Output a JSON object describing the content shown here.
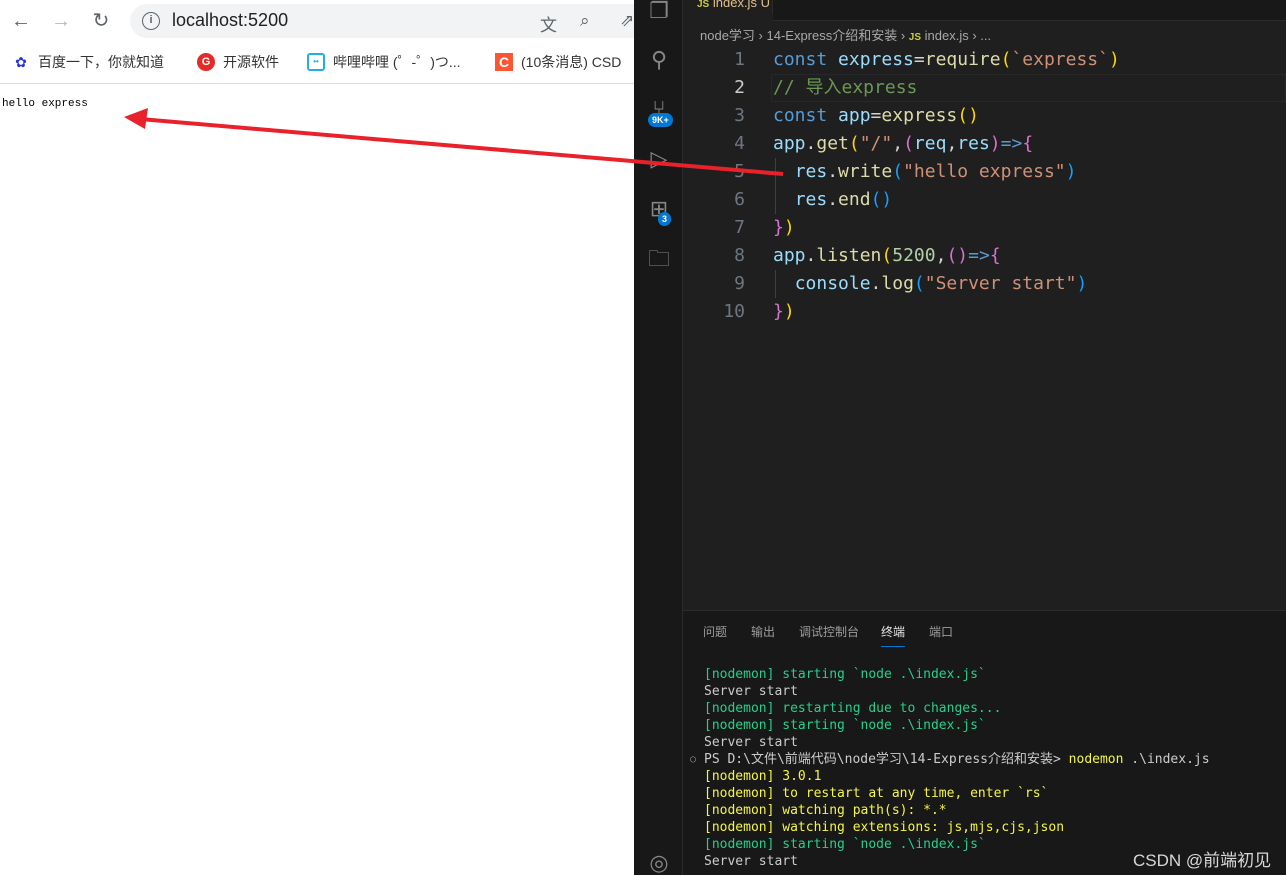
{
  "browser": {
    "url": "localhost:5200",
    "bookmarks": [
      {
        "label": "百度一下，你就知道",
        "icon": "baidu-icon"
      },
      {
        "label": "开源软件",
        "icon": "oschina-icon"
      },
      {
        "label": "哔哩哔哩 (゜-゜)つ...",
        "icon": "bilibili-icon"
      },
      {
        "label": "(10条消息) CSD",
        "icon": "csdn-icon"
      }
    ],
    "body_text": "hello express"
  },
  "editor": {
    "tab": {
      "icon": "JS",
      "name": "index.js",
      "status": "U"
    },
    "breadcrumb": [
      "node学习",
      "14-Express介绍和安装",
      "index.js",
      "..."
    ],
    "breadcrumb_js": "JS",
    "badges": {
      "source_control": "9K+",
      "extensions": "3"
    },
    "current_line": 2,
    "lines": [
      {
        "n": "1",
        "tokens": [
          [
            "kw",
            "const "
          ],
          [
            "var",
            "express"
          ],
          [
            "op",
            "="
          ],
          [
            "fn",
            "require"
          ],
          [
            "p1",
            "("
          ],
          [
            "str",
            "`express`"
          ],
          [
            "p1",
            ")"
          ]
        ]
      },
      {
        "n": "2",
        "tokens": [
          [
            "cm",
            "// 导入express"
          ]
        ]
      },
      {
        "n": "3",
        "tokens": [
          [
            "kw",
            "const "
          ],
          [
            "var",
            "app"
          ],
          [
            "op",
            "="
          ],
          [
            "fn",
            "express"
          ],
          [
            "p1",
            "()"
          ]
        ]
      },
      {
        "n": "4",
        "tokens": [
          [
            "var",
            "app"
          ],
          [
            "op",
            "."
          ],
          [
            "fn",
            "get"
          ],
          [
            "p1",
            "("
          ],
          [
            "str",
            "\"/\""
          ],
          [
            "op",
            ","
          ],
          [
            "p2",
            "("
          ],
          [
            "var",
            "req"
          ],
          [
            "op",
            ","
          ],
          [
            "var",
            "res"
          ],
          [
            "p2",
            ")"
          ],
          [
            "kw",
            "=>"
          ],
          [
            "p2",
            "{"
          ]
        ]
      },
      {
        "n": "5",
        "tokens": [
          [
            "op",
            "  "
          ],
          [
            "var",
            "res"
          ],
          [
            "op",
            "."
          ],
          [
            "fn",
            "write"
          ],
          [
            "p3",
            "("
          ],
          [
            "str",
            "\"hello express\""
          ],
          [
            "p3",
            ")"
          ]
        ]
      },
      {
        "n": "6",
        "tokens": [
          [
            "op",
            "  "
          ],
          [
            "var",
            "res"
          ],
          [
            "op",
            "."
          ],
          [
            "fn",
            "end"
          ],
          [
            "p3",
            "()"
          ]
        ]
      },
      {
        "n": "7",
        "tokens": [
          [
            "p2",
            "}"
          ],
          [
            "p1",
            ")"
          ]
        ]
      },
      {
        "n": "8",
        "tokens": [
          [
            "var",
            "app"
          ],
          [
            "op",
            "."
          ],
          [
            "fn",
            "listen"
          ],
          [
            "p1",
            "("
          ],
          [
            "num",
            "5200"
          ],
          [
            "op",
            ","
          ],
          [
            "p2",
            "()"
          ],
          [
            "kw",
            "=>"
          ],
          [
            "p2",
            "{"
          ]
        ]
      },
      {
        "n": "9",
        "tokens": [
          [
            "op",
            "  "
          ],
          [
            "var",
            "console"
          ],
          [
            "op",
            "."
          ],
          [
            "fn",
            "log"
          ],
          [
            "p3",
            "("
          ],
          [
            "str",
            "\"Server start\""
          ],
          [
            "p3",
            ")"
          ]
        ]
      },
      {
        "n": "10",
        "tokens": [
          [
            "p2",
            "}"
          ],
          [
            "p1",
            ")"
          ]
        ]
      }
    ]
  },
  "panel": {
    "tabs": [
      "问题",
      "输出",
      "调试控制台",
      "终端",
      "端口"
    ],
    "active_tab": "终端",
    "terminal": [
      {
        "c": "g",
        "t": "[nodemon] starting `node .\\index.js`"
      },
      {
        "c": "w",
        "t": "Server start"
      },
      {
        "c": "g",
        "t": "[nodemon] restarting due to changes..."
      },
      {
        "c": "g",
        "t": "[nodemon] starting `node .\\index.js`"
      },
      {
        "c": "w",
        "t": "Server start"
      },
      {
        "c": "w",
        "t": "PS D:\\文件\\前端代码\\node学习\\14-Express介绍和安装> ",
        "cmd": "nodemon",
        ".": "",
        "args": " .\\index.js",
        "prompt": true
      },
      {
        "c": "y",
        "t": "[nodemon] 3.0.1"
      },
      {
        "c": "y",
        "t": "[nodemon] to restart at any time, enter `rs`"
      },
      {
        "c": "y",
        "t": "[nodemon] watching path(s): *.*"
      },
      {
        "c": "y",
        "t": "[nodemon] watching extensions: js,mjs,cjs,json"
      },
      {
        "c": "g",
        "t": "[nodemon] starting `node .\\index.js`"
      },
      {
        "c": "w",
        "t": "Server start"
      }
    ]
  },
  "watermark": "CSDN @前端初见",
  "colors": {
    "annotation_arrow": "#e8212b",
    "accent": "#0078d4"
  }
}
